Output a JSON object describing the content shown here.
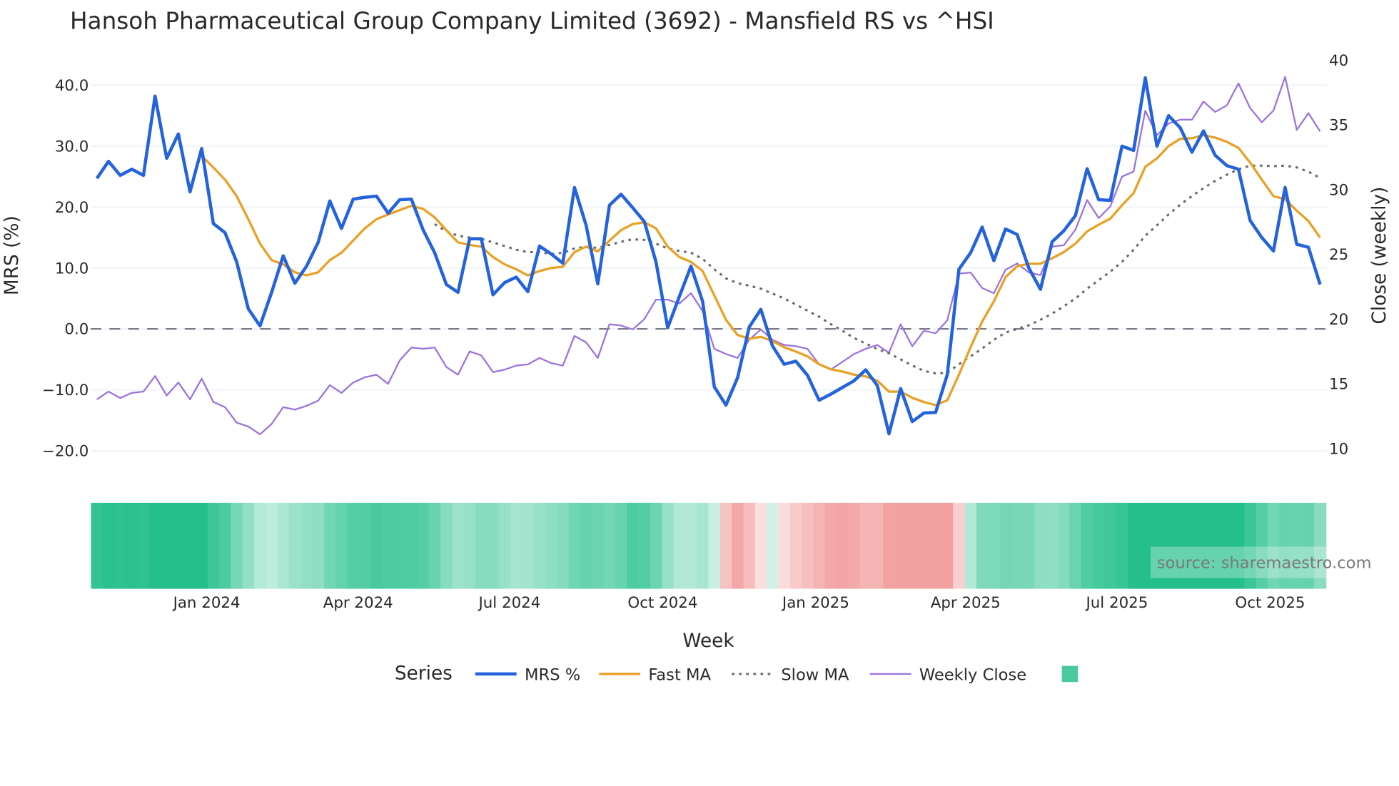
{
  "chart_data": {
    "type": "line",
    "title": "Hansoh Pharmaceutical Group Company Limited (3692) - Mansfield RS vs ^HSI",
    "xlabel": "Week",
    "ylabel": "MRS (%)",
    "y2label": "Close (weekly)",
    "source": "source: sharemaestro.com",
    "start_week": "2023-10-27",
    "week_step_days": 7,
    "ylim": [
      -23,
      44
    ],
    "y_ticks": [
      {
        "value": 40,
        "label": "40.0"
      },
      {
        "value": 30,
        "label": "30.0"
      },
      {
        "value": 20,
        "label": "20.0"
      },
      {
        "value": 10,
        "label": "10.0"
      },
      {
        "value": 0,
        "label": "0.0"
      },
      {
        "value": -10,
        "label": "−10.0"
      },
      {
        "value": -20,
        "label": "−20.0"
      }
    ],
    "y2_ticks": [
      {
        "value": 40,
        "label": "40"
      },
      {
        "value": 35,
        "label": "35"
      },
      {
        "value": 30,
        "label": "30"
      },
      {
        "value": 25,
        "label": "25"
      },
      {
        "value": 20,
        "label": "20"
      },
      {
        "value": 15,
        "label": "15"
      },
      {
        "value": 10,
        "label": "10"
      }
    ],
    "x_ticks": [
      {
        "date": "2024-01-01",
        "label": "Jan 2024"
      },
      {
        "date": "2024-04-01",
        "label": "Apr 2024"
      },
      {
        "date": "2024-07-01",
        "label": "Jul 2024"
      },
      {
        "date": "2024-10-01",
        "label": "Oct 2024"
      },
      {
        "date": "2025-01-01",
        "label": "Jan 2025"
      },
      {
        "date": "2025-04-01",
        "label": "Apr 2025"
      },
      {
        "date": "2025-07-01",
        "label": "Jul 2025"
      },
      {
        "date": "2025-10-01",
        "label": "Oct 2025"
      }
    ],
    "legend": {
      "title": "Series",
      "placement": "bottom-center"
    },
    "series": [
      {
        "name": "MRS %",
        "axis": "left",
        "color": "#2563dc",
        "style": "solid-thick",
        "offset": 0,
        "values": [
          24.7,
          27.5,
          25.2,
          26.2,
          25.2,
          38.2,
          28,
          32,
          22.5,
          29.6,
          17.3,
          15.8,
          11,
          3.3,
          0.5,
          6,
          12,
          7.5,
          10.3,
          14.2,
          21,
          16.5,
          21.3,
          21.6,
          21.8,
          19,
          21.2,
          21.3,
          16.3,
          12.5,
          7.3,
          6,
          14.8,
          14.8,
          5.6,
          7.6,
          8.5,
          6.1,
          13.6,
          12.3,
          10.8,
          23.2,
          17,
          7.4,
          20.3,
          22.1,
          19.9,
          17.6,
          11,
          0.2,
          5.3,
          10.3,
          4.5,
          -9.5,
          -12.5,
          -8,
          0.3,
          3.2,
          -2.8,
          -5.8,
          -5.3,
          -7.6,
          -11.7,
          -10.7,
          -9.6,
          -8.5,
          -6.7,
          -9.3,
          -17.2,
          -9.8,
          -15.2,
          -13.8,
          -13.7,
          -7.5,
          9.8,
          12.5,
          16.7,
          11.2,
          16.4,
          15.5,
          10,
          6.5,
          14.3,
          16.1,
          18.6,
          26.3,
          21.2,
          21.1,
          30,
          29.3,
          41.2,
          30,
          35,
          33,
          29,
          32.5,
          28.5,
          26.8,
          26.2,
          17.8,
          15,
          12.8,
          23.2,
          13.9,
          13.4,
          7.3
        ]
      },
      {
        "name": "Fast MA",
        "axis": "left",
        "color": "#e9a023",
        "style": "solid",
        "offset": 9,
        "values": [
          28.4,
          26.5,
          24.5,
          21.8,
          18,
          14,
          11.3,
          10.6,
          9.3,
          8.8,
          9.3,
          11.3,
          12.5,
          14.5,
          16.5,
          18,
          18.8,
          19.5,
          20.2,
          19.7,
          18.3,
          16.2,
          14.2,
          13.8,
          13.5,
          11.8,
          10.6,
          9.8,
          8.8,
          9.5,
          10,
          10.2,
          12.6,
          13.5,
          12.7,
          14.5,
          16.2,
          17.2,
          17.5,
          16.5,
          13.5,
          11.8,
          11,
          9.5,
          5.5,
          1.5,
          -1,
          -1.6,
          -1.3,
          -2,
          -3,
          -3.7,
          -4.5,
          -5.8,
          -6.6,
          -7,
          -7.5,
          -7.8,
          -8.5,
          -10.3,
          -10.3,
          -11.3,
          -12,
          -12.5,
          -11.7,
          -7.5,
          -3,
          1.2,
          4.5,
          8.5,
          10.3,
          10.7,
          10.7,
          11.6,
          12.6,
          14,
          16,
          17.1,
          18.1,
          20.3,
          22.3,
          26.6,
          28,
          30,
          31.2,
          31.3,
          31.8,
          31.4,
          30.7,
          29.7,
          27.3,
          24.5,
          21.8,
          21.3,
          19.4,
          17.7,
          15
        ]
      },
      {
        "name": "Slow MA",
        "axis": "left",
        "color": "#6b6b6b",
        "style": "dotted",
        "offset": 29,
        "values": [
          17.2,
          16,
          15.3,
          15,
          14.8,
          14.2,
          13.6,
          13,
          12.6,
          12.6,
          12.3,
          12.5,
          13.2,
          13.5,
          13.3,
          13.8,
          14.3,
          14.7,
          14.6,
          14,
          13.2,
          12.8,
          12.5,
          11.5,
          9.8,
          8.3,
          7.5,
          7.1,
          6.6,
          5.8,
          5,
          4,
          3,
          2,
          0.8,
          -0.3,
          -1.5,
          -2.4,
          -3.3,
          -4,
          -5,
          -6,
          -6.9,
          -7.3,
          -7.2,
          -5.8,
          -4.5,
          -3.2,
          -1.8,
          -0.6,
          0,
          0.6,
          1.5,
          2.5,
          3.7,
          5,
          6.6,
          8,
          9.4,
          11,
          13,
          15.3,
          17,
          18.8,
          20.4,
          21.8,
          23.1,
          24.3,
          25.3,
          26.2,
          26.8,
          26.8,
          26.7,
          26.8,
          26.5,
          25.8,
          24.8
        ]
      },
      {
        "name": "Weekly Close",
        "axis": "right",
        "color": "#9b72e0",
        "style": "solid-thin",
        "offset": 0,
        "values": [
          13.8,
          14.4,
          13.9,
          14.3,
          14.4,
          15.6,
          14.1,
          15.1,
          13.8,
          15.4,
          13.6,
          13.2,
          12.0,
          11.7,
          11.1,
          11.9,
          13.2,
          13.0,
          13.3,
          13.7,
          14.9,
          14.3,
          15.1,
          15.5,
          15.7,
          15.0,
          16.8,
          17.8,
          17.7,
          17.8,
          16.3,
          15.7,
          17.5,
          17.2,
          15.9,
          16.1,
          16.4,
          16.5,
          17.0,
          16.6,
          16.4,
          18.7,
          18.2,
          17.0,
          19.6,
          19.5,
          19.2,
          20.0,
          21.5,
          21.5,
          21.2,
          22.0,
          20.6,
          17.7,
          17.3,
          17.0,
          18.4,
          19.2,
          18.4,
          18.0,
          17.9,
          17.7,
          16.5,
          16.1,
          16.7,
          17.3,
          17.7,
          18.0,
          17.4,
          19.6,
          17.9,
          19.1,
          18.9,
          19.9,
          23.5,
          23.6,
          22.4,
          22.0,
          23.8,
          24.3,
          23.6,
          23.4,
          25.6,
          25.7,
          26.9,
          29.2,
          27.8,
          28.7,
          31.0,
          31.4,
          36.1,
          34.2,
          35.1,
          35.4,
          35.4,
          36.8,
          36.0,
          36.5,
          38.2,
          36.3,
          35.2,
          36.1,
          38.7,
          34.6,
          35.9,
          34.5
        ]
      }
    ],
    "reference_line": {
      "value": 0,
      "style": "dashed"
    },
    "heatmap": {
      "source_series": "MRS %",
      "smoothing_weeks": 3,
      "positive_color": "#24bf8b",
      "negative_color": "#f3a0a0",
      "legend_color": "#4cc99e"
    }
  }
}
